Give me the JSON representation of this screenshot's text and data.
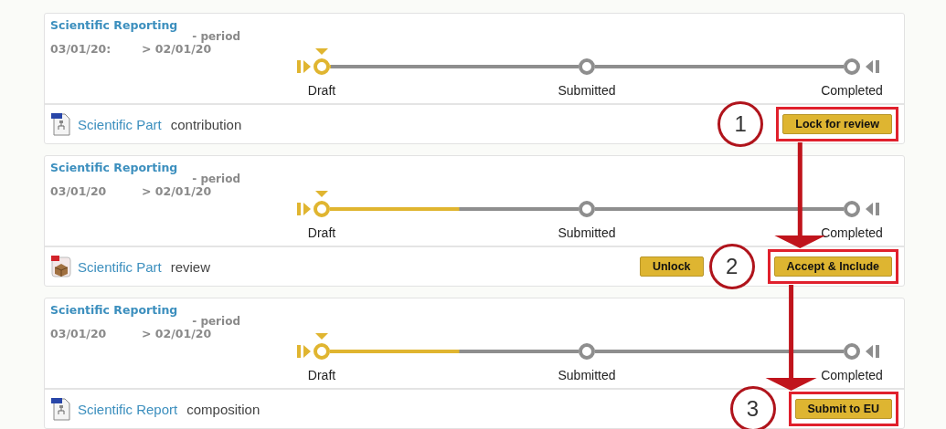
{
  "panels": [
    {
      "title": "Scientific Reporting",
      "period_label": "- period",
      "start_date": "03/01/20:",
      "end_date": "> 02/01/20",
      "stages": [
        {
          "label": "Draft",
          "current": true
        },
        {
          "label": "Submitted",
          "current": false
        },
        {
          "label": "Completed",
          "current": false
        }
      ],
      "progress": {
        "level": 0
      },
      "document": {
        "kind": "diagram",
        "link": "Scientific Part",
        "text": "contribution"
      },
      "step": "1",
      "actions": [
        {
          "label": "Lock for review",
          "highlighted": true
        }
      ]
    },
    {
      "title": "Scientific Reporting",
      "period_label": "- period",
      "start_date": "03/01/20",
      "end_date": "> 02/01/20",
      "stages": [
        {
          "label": "Draft",
          "current": true
        },
        {
          "label": "Submitted",
          "current": false
        },
        {
          "label": "Completed",
          "current": false
        }
      ],
      "progress": {
        "level": 0.52
      },
      "document": {
        "kind": "package",
        "link": "Scientific Part",
        "text": "review"
      },
      "step": "2",
      "actions": [
        {
          "label": "Unlock",
          "highlighted": false
        },
        {
          "label": "Accept & Include",
          "highlighted": true
        }
      ]
    },
    {
      "title": "Scientific Reporting",
      "period_label": "- period",
      "start_date": "03/01/20",
      "end_date": "> 02/01/20",
      "stages": [
        {
          "label": "Draft",
          "current": true
        },
        {
          "label": "Submitted",
          "current": false
        },
        {
          "label": "Completed",
          "current": false
        }
      ],
      "progress": {
        "level": 0.52
      },
      "document": {
        "kind": "diagram",
        "link": "Scientific Report",
        "text": "composition"
      },
      "step": "3",
      "actions": [
        {
          "label": "Submit to EU",
          "highlighted": true
        }
      ]
    }
  ]
}
